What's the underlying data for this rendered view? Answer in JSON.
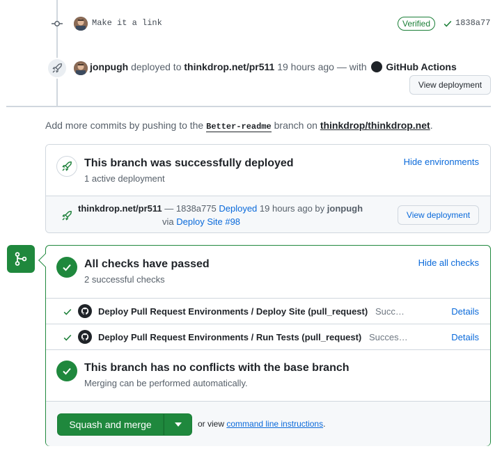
{
  "timeline": {
    "commit": {
      "message": "Make it a link",
      "verified_label": "Verified",
      "sha": "1838a77"
    },
    "deploy_event": {
      "user": "jonpugh",
      "action": "deployed to",
      "target": "thinkdrop.net/pr511",
      "time": "19 hours ago",
      "with_text": "— with",
      "app": "GitHub Actions",
      "view_button": "View deployment"
    }
  },
  "add_more": {
    "prefix": "Add more commits by pushing to the",
    "branch": "Better-readme",
    "middle": "branch on",
    "repo": "thinkdrop/thinkdrop.net",
    "suffix": "."
  },
  "deploy_card": {
    "title": "This branch was successfully deployed",
    "subtitle": "1 active deployment",
    "hide_link": "Hide environments",
    "env_name": "thinkdrop.net/pr511",
    "env_sep": "—",
    "env_sha": "1838a775",
    "env_status": "Deployed",
    "env_time": "19 hours ago by",
    "env_user": "jonpugh",
    "via": "via",
    "via_link": "Deploy Site #98",
    "view_button": "View deployment"
  },
  "checks": {
    "title": "All checks have passed",
    "subtitle": "2 successful checks",
    "hide_link": "Hide all checks",
    "items": [
      {
        "name": "Deploy Pull Request Environments / Deploy Site (pull_request)",
        "status": "Succ…",
        "details": "Details"
      },
      {
        "name": "Deploy Pull Request Environments / Run Tests (pull_request)",
        "status": "Succes…",
        "details": "Details"
      }
    ]
  },
  "conflicts": {
    "title": "This branch has no conflicts with the base branch",
    "subtitle": "Merging can be performed automatically."
  },
  "merge": {
    "button": "Squash and merge",
    "or_view": "or view",
    "cli_link": "command line instructions",
    "period": "."
  },
  "colors": {
    "success": "#1f883d",
    "link": "#0969da",
    "border": "#d0d7de"
  }
}
